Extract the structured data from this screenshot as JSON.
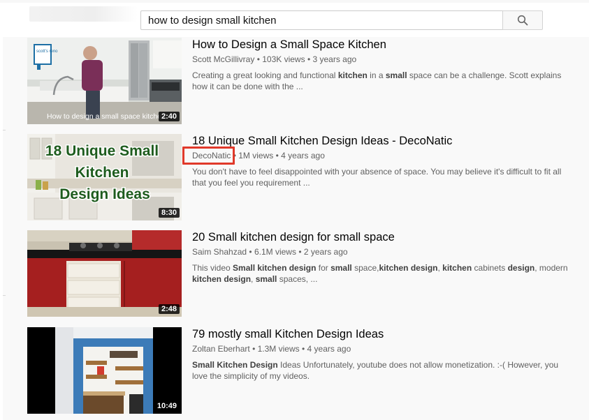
{
  "search": {
    "query": "how to design small kitchen"
  },
  "icons": {
    "search": "search-icon"
  },
  "results": [
    {
      "title": "How to Design a Small Space Kitchen",
      "channel": "Scott McGillivray",
      "views": "103K views",
      "age": "3 years ago",
      "description_parts": [
        {
          "t": "Creating a great looking and functional ",
          "b": false
        },
        {
          "t": "kitchen",
          "b": true
        },
        {
          "t": " in a ",
          "b": false
        },
        {
          "t": "small",
          "b": true
        },
        {
          "t": " space can be a challenge. Scott explains how it can be done with the ...",
          "b": false
        }
      ],
      "duration": "2:40",
      "thumb_caption": "How to design a small space kitche",
      "thumb_logo_text": "scott's reno"
    },
    {
      "title": "18 Unique Small Kitchen Design Ideas - DecoNatic",
      "channel": "DecoNatic",
      "views": "1M views",
      "age": "4 years ago",
      "description_parts": [
        {
          "t": "You don't have to feel disappointed with your absence of space. You may believe it's difficult to fit all that you feel you requirement ...",
          "b": false
        }
      ],
      "duration": "8:30",
      "thumb_text_lines": [
        "18 Unique Small",
        "Kitchen",
        "Design Ideas"
      ]
    },
    {
      "title": "20 Small kitchen design for small space",
      "channel": "Saim Shahzad",
      "views": "6.1M views",
      "age": "2 years ago",
      "description_parts": [
        {
          "t": "This video ",
          "b": false
        },
        {
          "t": "Small kitchen design",
          "b": true
        },
        {
          "t": " for ",
          "b": false
        },
        {
          "t": "small",
          "b": true
        },
        {
          "t": " space,",
          "b": false
        },
        {
          "t": "kitchen design",
          "b": true
        },
        {
          "t": ", ",
          "b": false
        },
        {
          "t": "kitchen",
          "b": true
        },
        {
          "t": " cabinets ",
          "b": false
        },
        {
          "t": "design",
          "b": true
        },
        {
          "t": ", modern ",
          "b": false
        },
        {
          "t": "kitchen design",
          "b": true
        },
        {
          "t": ", ",
          "b": false
        },
        {
          "t": "small",
          "b": true
        },
        {
          "t": " spaces, ...",
          "b": false
        }
      ],
      "duration": "2:48"
    },
    {
      "title": "79 mostly small Kitchen Design Ideas",
      "channel": "Zoltan Eberhart",
      "views": "1.3M views",
      "age": "4 years ago",
      "description_parts": [
        {
          "t": "Small Kitchen Design",
          "b": true
        },
        {
          "t": " Ideas Unfortunately, youtube does not allow monetization. :-( However, you love the simplicity of my videos.",
          "b": false
        }
      ],
      "duration": "10:49"
    }
  ],
  "meta_separator": "•",
  "colors": {
    "highlight_box": "#e0392a",
    "title_text": "#030303",
    "meta_text": "#606060",
    "results_background": "#f9f9f9"
  }
}
